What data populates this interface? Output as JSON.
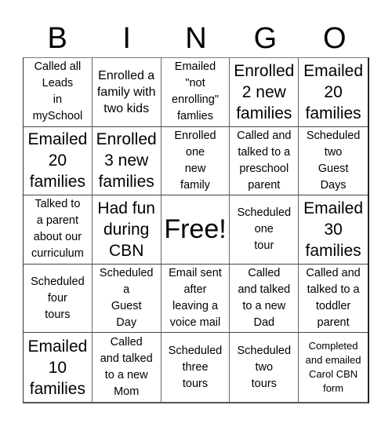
{
  "header": {
    "letters": [
      "B",
      "I",
      "N",
      "G",
      "O"
    ]
  },
  "cells": [
    {
      "text": "Called all\nLeads\nin\nmySchool",
      "size": "s-sm"
    },
    {
      "text": "Enrolled a\nfamily with\ntwo kids",
      "size": "s-md"
    },
    {
      "text": "Emailed\n\"not\nenrolling\"\nfamlies",
      "size": "s-sm"
    },
    {
      "text": "Enrolled\n2 new\nfamilies",
      "size": "s-lg"
    },
    {
      "text": "Emailed\n20\nfamilies",
      "size": "s-lg"
    },
    {
      "text": "Emailed\n20\nfamilies",
      "size": "s-lg"
    },
    {
      "text": "Enrolled\n3 new\nfamilies",
      "size": "s-lg"
    },
    {
      "text": "Enrolled\none\nnew\nfamily",
      "size": "s-sm"
    },
    {
      "text": "Called and\ntalked to a\npreschool\nparent",
      "size": "s-sm"
    },
    {
      "text": "Scheduled\ntwo\nGuest\nDays",
      "size": "s-sm"
    },
    {
      "text": "Talked to\na parent\nabout our\ncurriculum",
      "size": "s-sm"
    },
    {
      "text": "Had fun\nduring\nCBN",
      "size": "s-lg"
    },
    {
      "text": "Free!",
      "size": "s-free"
    },
    {
      "text": "Scheduled\none\ntour",
      "size": "s-sm"
    },
    {
      "text": "Emailed\n30\nfamilies",
      "size": "s-lg"
    },
    {
      "text": "Scheduled\nfour\ntours",
      "size": "s-sm"
    },
    {
      "text": "Scheduled\na\nGuest\nDay",
      "size": "s-sm"
    },
    {
      "text": "Email sent\nafter\nleaving a\nvoice mail",
      "size": "s-sm"
    },
    {
      "text": "Called\nand talked\nto a new\nDad",
      "size": "s-sm"
    },
    {
      "text": "Called and\ntalked to a\ntoddler\nparent",
      "size": "s-sm"
    },
    {
      "text": "Emailed\n10\nfamilies",
      "size": "s-lg"
    },
    {
      "text": "Called\nand talked\nto a new\nMom",
      "size": "s-sm"
    },
    {
      "text": "Scheduled\nthree\ntours",
      "size": "s-sm"
    },
    {
      "text": "Scheduled\ntwo\ntours",
      "size": "s-sm"
    },
    {
      "text": "Completed\nand emailed\nCarol CBN\nform",
      "size": "s-xs"
    }
  ]
}
